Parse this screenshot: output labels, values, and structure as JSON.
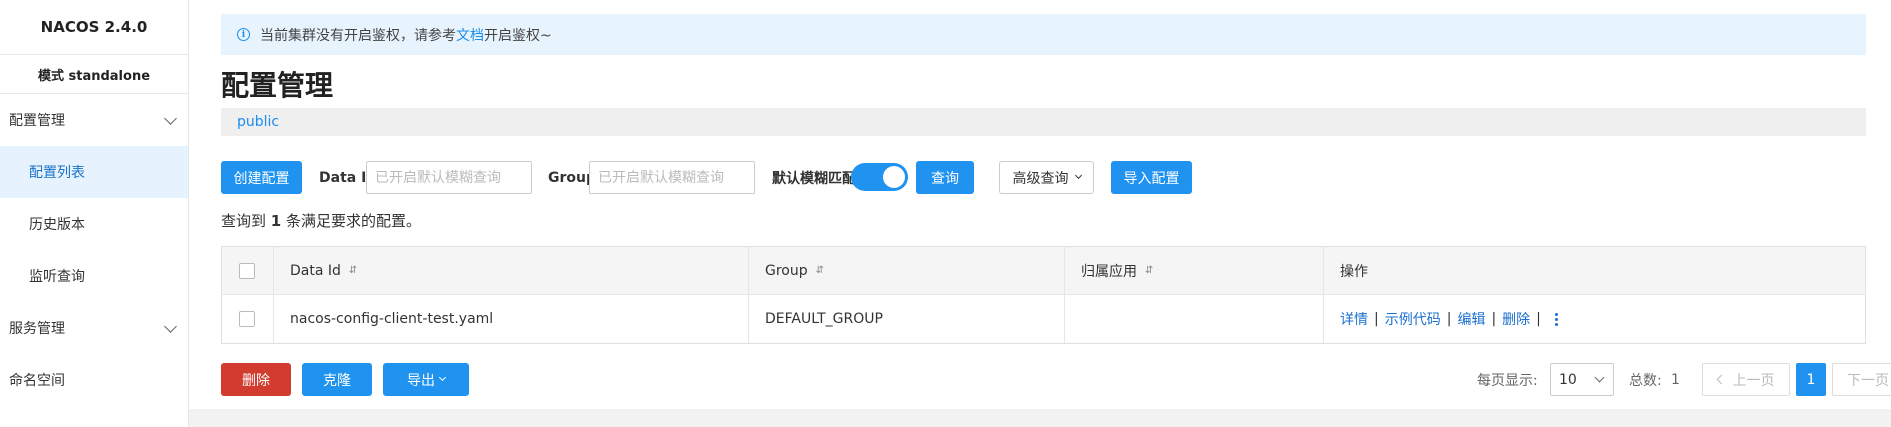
{
  "sidebar": {
    "brand": "NACOS 2.4.0",
    "mode": "模式 standalone",
    "groups": [
      {
        "label": "配置管理",
        "items": [
          "配置列表",
          "历史版本",
          "监听查询"
        ]
      },
      {
        "label": "服务管理"
      },
      {
        "label": "命名空间"
      }
    ]
  },
  "notice": {
    "before": "当前集群没有开启鉴权，请参考",
    "link": "文档",
    "after": "开启鉴权~"
  },
  "page": {
    "title": "配置管理",
    "namespace": "public"
  },
  "toolbar": {
    "create": "创建配置",
    "data_id_label": "Data ID",
    "data_id_placeholder": "已开启默认模糊查询",
    "group_label": "Group",
    "group_placeholder": "已开启默认模糊查询",
    "fuzzy_label": "默认模糊匹配",
    "fuzzy_on": true,
    "query": "查询",
    "advanced": "高级查询",
    "import": "导入配置"
  },
  "result": {
    "prefix": "查询到",
    "count": "1",
    "suffix": "条满足要求的配置。"
  },
  "table": {
    "columns": [
      "Data Id",
      "Group",
      "归属应用",
      "操作"
    ],
    "rows": [
      {
        "data_id": "nacos-config-client-test.yaml",
        "group": "DEFAULT_GROUP",
        "app": ""
      }
    ],
    "actions": [
      "详情",
      "示例代码",
      "编辑",
      "删除"
    ]
  },
  "footer": {
    "delete": "删除",
    "clone": "克隆",
    "export": "导出",
    "page_size_label": "每页显示:",
    "page_size": "10",
    "total_label": "总数:",
    "total": "1",
    "prev": "上一页",
    "current_page": "1",
    "next": "下一页"
  },
  "colors": {
    "primary": "#1f93ef",
    "danger": "#d23c2e",
    "active_nav_bg": "#e6f2fd",
    "notice_bg": "#e8f4fd"
  }
}
